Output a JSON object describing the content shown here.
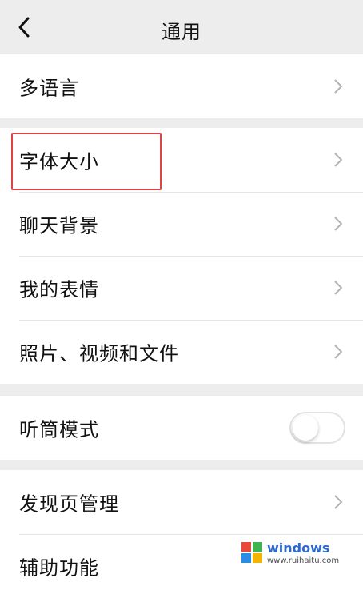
{
  "header": {
    "title": "通用"
  },
  "sections": [
    {
      "items": [
        {
          "label": "多语言"
        }
      ]
    },
    {
      "items": [
        {
          "label": "字体大小"
        },
        {
          "label": "聊天背景"
        },
        {
          "label": "我的表情"
        },
        {
          "label": "照片、视频和文件"
        }
      ]
    },
    {
      "items": [
        {
          "label": "听筒模式"
        }
      ]
    },
    {
      "items": [
        {
          "label": "发现页管理"
        },
        {
          "label": "辅助功能"
        }
      ]
    }
  ],
  "earpiece_mode_enabled": false,
  "watermark": {
    "text": "windows",
    "sub": "www.ruihaitu.com"
  }
}
